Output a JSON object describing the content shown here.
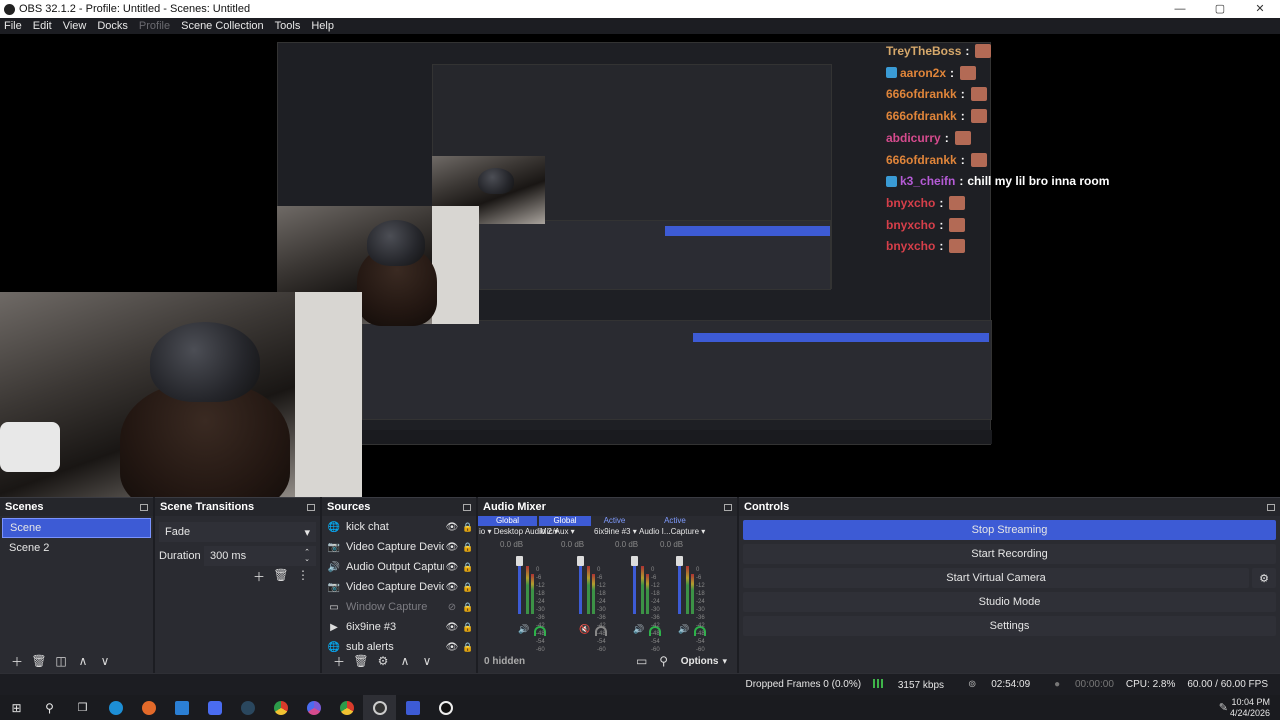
{
  "window": {
    "title": "OBS 32.1.2 - Profile: Untitled - Scenes: Untitled",
    "controls": [
      "—",
      "▢",
      "✕"
    ]
  },
  "menu": [
    "File",
    "Edit",
    "View",
    "Docks",
    "Profile",
    "Scene Collection",
    "Tools",
    "Help"
  ],
  "chat": [
    {
      "user": "TreyTheBoss",
      "color": "#d6a86b",
      "badge": false,
      "msg": ""
    },
    {
      "user": "aaron2x",
      "color": "#e0853a",
      "badge": true,
      "msg": ""
    },
    {
      "user": "666ofdrankk",
      "color": "#e0853a",
      "badge": false,
      "msg": ""
    },
    {
      "user": "666ofdrankk",
      "color": "#e0853a",
      "badge": false,
      "msg": ""
    },
    {
      "user": "abdicurry",
      "color": "#d64b8e",
      "badge": false,
      "msg": ""
    },
    {
      "user": "666ofdrankk",
      "color": "#e0853a",
      "badge": false,
      "msg": ""
    },
    {
      "user": "k3_cheifn",
      "color": "#b55bd6",
      "badge": true,
      "msg": "chill my lil bro inna room"
    },
    {
      "user": "bnyxcho",
      "color": "#d63f4a",
      "badge": false,
      "msg": ""
    },
    {
      "user": "bnyxcho",
      "color": "#d63f4a",
      "badge": false,
      "msg": ""
    },
    {
      "user": "bnyxcho",
      "color": "#d63f4a",
      "badge": false,
      "msg": ""
    }
  ],
  "scenes": {
    "title": "Scenes",
    "items": [
      "Scene",
      "Scene 2"
    ]
  },
  "transitions": {
    "title": "Scene Transitions",
    "type": "Fade",
    "duration_label": "Duration",
    "duration_value": "300 ms"
  },
  "sources": {
    "title": "Sources",
    "items": [
      {
        "name": "kick chat",
        "icon": "🌐",
        "dim": false
      },
      {
        "name": "Video Capture Device",
        "icon": "📷",
        "dim": false
      },
      {
        "name": "Audio Output Capture",
        "icon": "🔊",
        "dim": false
      },
      {
        "name": "Video Capture Device",
        "icon": "📷",
        "dim": false
      },
      {
        "name": "Window Capture",
        "icon": "▭",
        "dim": true
      },
      {
        "name": "6ix9ine #3",
        "icon": "▶",
        "dim": false
      },
      {
        "name": "sub alerts",
        "icon": "🌐",
        "dim": false
      }
    ]
  },
  "mixer": {
    "title": "Audio Mixer",
    "channels": [
      {
        "name": "Desktop Audio 2",
        "name_shown": "io ▾ Desktop Audio 2 ▾",
        "tag": "Global",
        "db": "0.0 dB",
        "muted": false
      },
      {
        "name": "Mic/Aux",
        "name_shown": "Mic/Aux ▾",
        "tag": "Global",
        "db": "0.0 dB",
        "muted": true
      },
      {
        "name": "6ix9ine #3",
        "name_shown": "6ix9ine #3 ▾",
        "tag": "Active",
        "db": "0.0 dB",
        "muted": false
      },
      {
        "name": "Audio Output Capture",
        "name_shown": "Audio I...Capture ▾",
        "tag": "Active",
        "db": "0.0 dB",
        "muted": false
      }
    ],
    "scale": [
      "0",
      "-6",
      "-12",
      "-18",
      "-24",
      "-30",
      "-36",
      "-42",
      "-48",
      "-54",
      "-60"
    ],
    "hidden": "0 hidden",
    "options": "Options"
  },
  "controls": {
    "title": "Controls",
    "buttons": [
      "Stop Streaming",
      "Start Recording",
      "Start Virtual Camera",
      "Studio Mode",
      "Settings"
    ]
  },
  "status": {
    "dropped": "Dropped Frames 0 (0.0%)",
    "bitrate": "3157 kbps",
    "stream_time": "02:54:09",
    "rec_time": "00:00:00",
    "cpu": "CPU: 2.8%",
    "fps": "60.00 / 60.00 FPS"
  },
  "clock": {
    "time": "10:04 PM",
    "date": "4/24/2026"
  },
  "colors": {
    "accent": "#3d5bd5",
    "panel": "#2a2b31",
    "bg": "#1c1d22"
  }
}
